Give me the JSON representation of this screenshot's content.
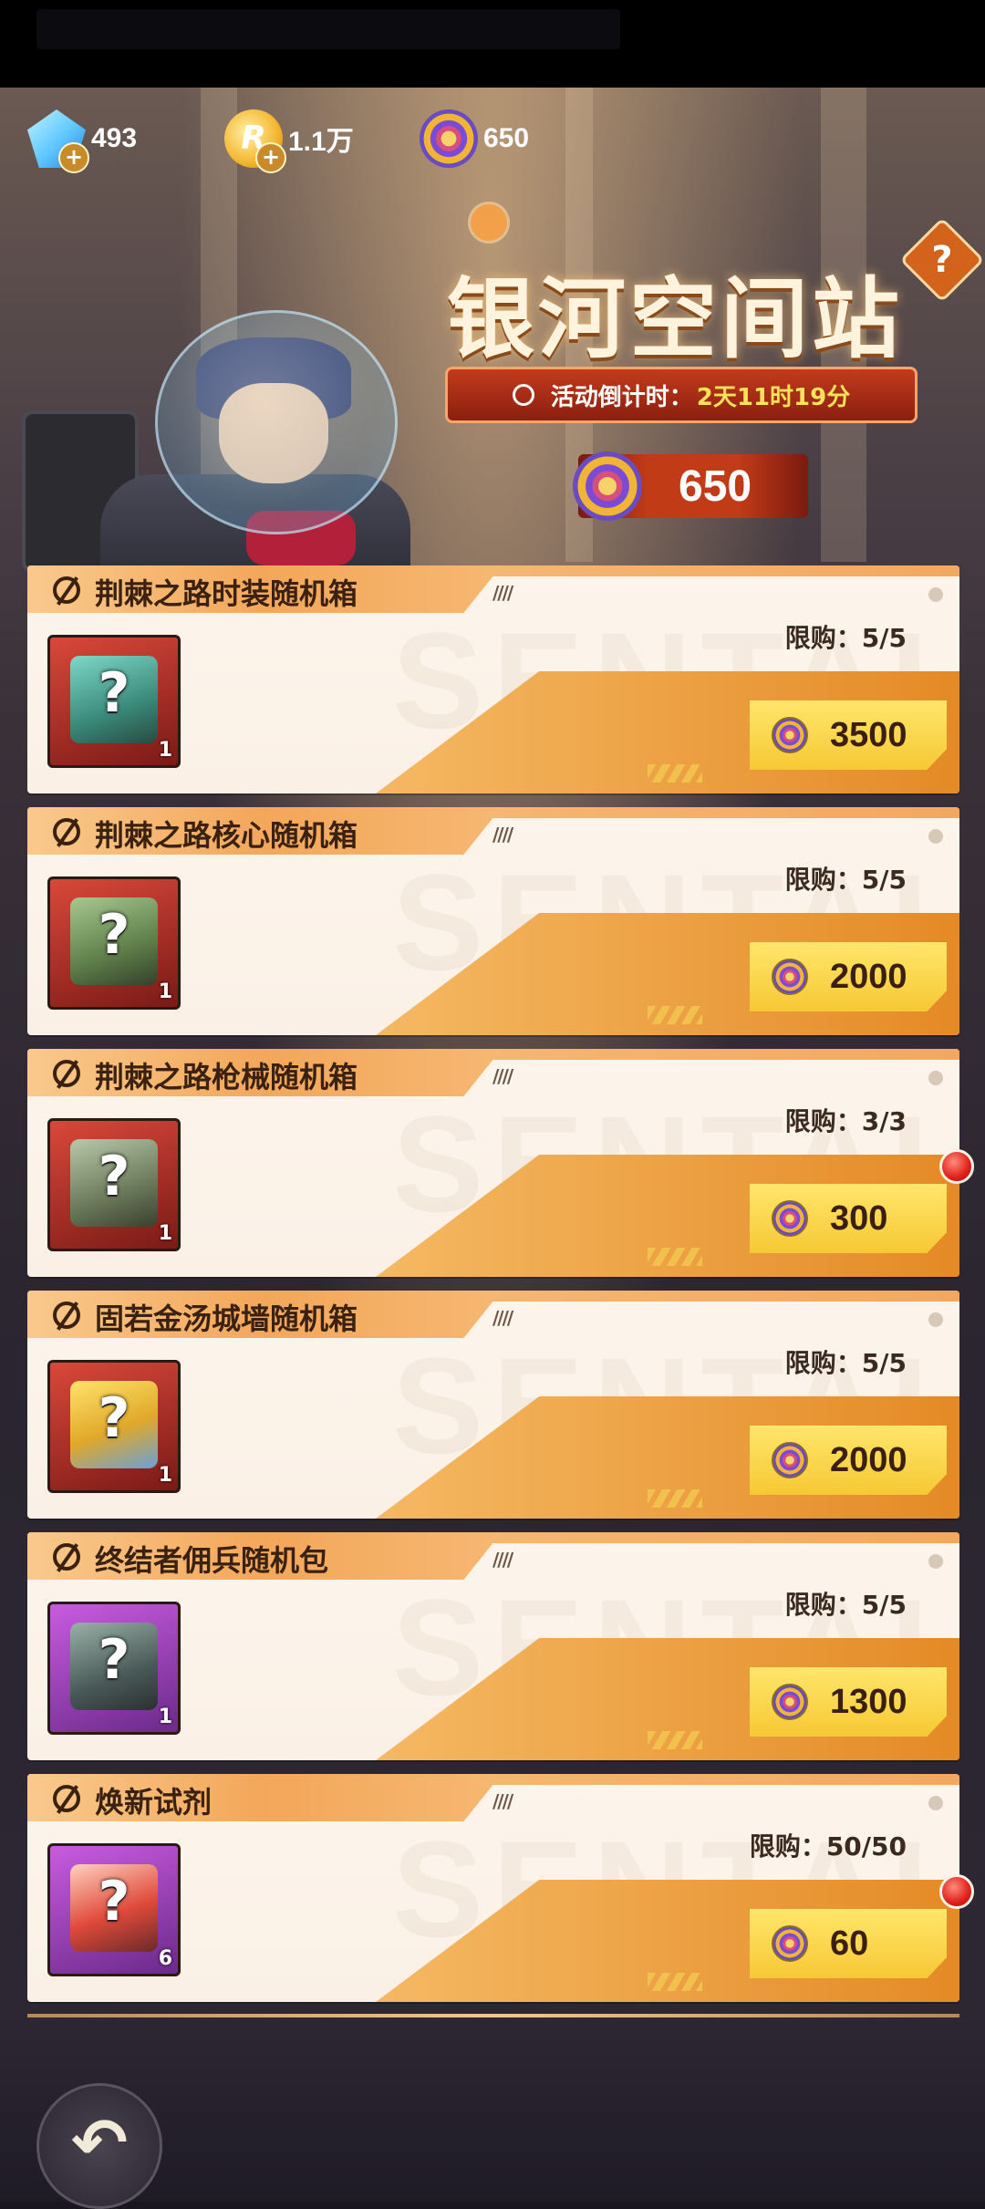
{
  "currencies": [
    {
      "icon": "diamond-gem-icon",
      "value": "493"
    },
    {
      "icon": "r-coin-icon",
      "value": "1.1万",
      "glyph": "R"
    },
    {
      "icon": "galaxy-token-icon",
      "value": "650"
    }
  ],
  "event": {
    "title": "银河空间站",
    "help_glyph": "?",
    "countdown_label": "活动倒计时：",
    "countdown_value": "2天11时19分",
    "balance": "650"
  },
  "items": [
    {
      "name": "荆棘之路时装随机箱",
      "count": "1",
      "limit": "限购：5/5",
      "price": "3500",
      "red_dot": false,
      "frame": "red"
    },
    {
      "name": "荆棘之路核心随机箱",
      "count": "1",
      "limit": "限购：5/5",
      "price": "2000",
      "red_dot": false,
      "frame": "red"
    },
    {
      "name": "荆棘之路枪械随机箱",
      "count": "1",
      "limit": "限购：3/3",
      "price": "300",
      "red_dot": true,
      "frame": "red"
    },
    {
      "name": "固若金汤城墙随机箱",
      "count": "1",
      "limit": "限购：5/5",
      "price": "2000",
      "red_dot": false,
      "frame": "red"
    },
    {
      "name": "终结者佣兵随机包",
      "count": "1",
      "limit": "限购：5/5",
      "price": "1300",
      "red_dot": false,
      "frame": "purple"
    },
    {
      "name": "焕新试剂",
      "count": "6",
      "limit": "限购：50/50",
      "price": "60",
      "red_dot": true,
      "frame": "purple"
    }
  ],
  "card_decor": {
    "hatch": "////",
    "watermark": "SENTAUR",
    "mystery_glyph": "?"
  },
  "nav": {
    "back_glyph": "↶"
  },
  "colors": {
    "accent": "#f3a75a",
    "price_button": "#f6c834",
    "countdown_bg": "#c33b1b",
    "highlight": "#ffe15c"
  }
}
